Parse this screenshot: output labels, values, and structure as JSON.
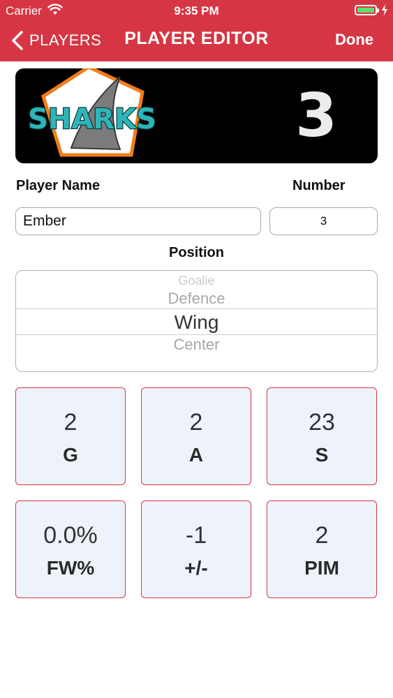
{
  "status_bar": {
    "carrier": "Carrier",
    "time": "9:35 PM"
  },
  "nav": {
    "back_label": "PLAYERS",
    "title": "PLAYER EDITOR",
    "done_label": "Done"
  },
  "banner": {
    "team_logo_text": "SHARKS",
    "jersey_number": "3"
  },
  "form": {
    "player_name_label": "Player Name",
    "number_label": "Number",
    "player_name_value": "Ember",
    "number_value": "3",
    "position_label": "Position"
  },
  "position_picker": {
    "options": [
      "Goalie",
      "Defence",
      "Wing",
      "Center"
    ],
    "selected": "Wing"
  },
  "stats": [
    {
      "value": "2",
      "label": "G"
    },
    {
      "value": "2",
      "label": "A"
    },
    {
      "value": "23",
      "label": "S"
    },
    {
      "value": "0.0%",
      "label": "FW%"
    },
    {
      "value": "-1",
      "label": "+/-"
    },
    {
      "value": "2",
      "label": "PIM"
    }
  ],
  "colors": {
    "header": "#d63644",
    "tile_border": "#d63644",
    "tile_fill": "#eef3fb",
    "banner": "#000000",
    "logo_teal": "#2fb5b7",
    "logo_orange": "#f07d1a"
  }
}
